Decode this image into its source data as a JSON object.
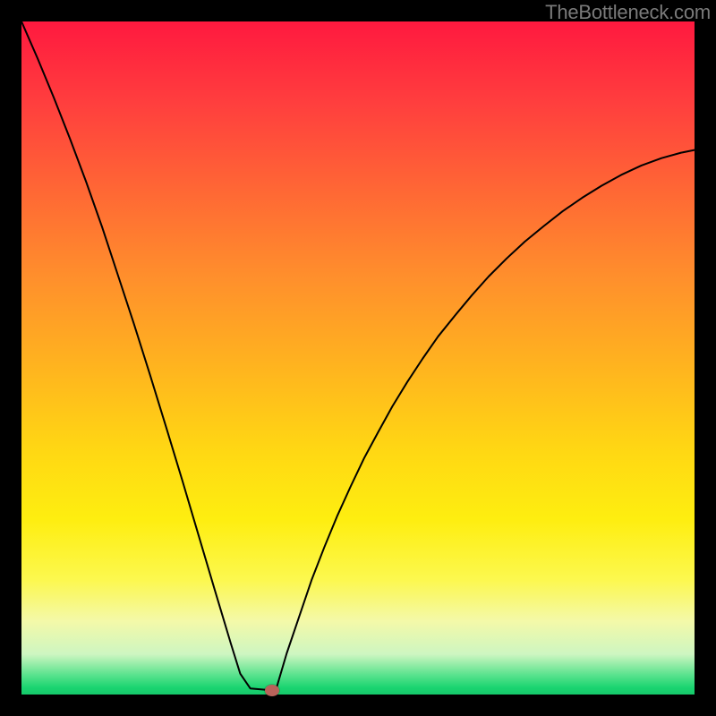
{
  "watermark": {
    "text": "TheBottleneck.com"
  },
  "plot": {
    "inner_left": 24,
    "inner_top": 24,
    "inner_width": 752,
    "inner_height": 752
  },
  "cursor": {
    "x_frac": 0.3723,
    "y_frac": 0.994,
    "color": "#b9625a"
  },
  "chart_data": {
    "type": "line",
    "title": "",
    "xlabel": "",
    "ylabel": "",
    "xlim": [
      0,
      1
    ],
    "ylim": [
      0,
      1
    ],
    "legend": false,
    "grid": false,
    "series": [
      {
        "name": "bottleneck-curve-left",
        "x": [
          0.0,
          0.024,
          0.048,
          0.072,
          0.096,
          0.12,
          0.143,
          0.167,
          0.191,
          0.215,
          0.239,
          0.263,
          0.287,
          0.311,
          0.325,
          0.34,
          0.375
        ],
        "values": [
          1.0,
          0.945,
          0.887,
          0.826,
          0.762,
          0.694,
          0.624,
          0.551,
          0.475,
          0.397,
          0.318,
          0.237,
          0.156,
          0.076,
          0.031,
          0.009,
          0.006
        ]
      },
      {
        "name": "bottleneck-curve-right",
        "x": [
          0.376,
          0.394,
          0.413,
          0.431,
          0.45,
          0.469,
          0.489,
          0.509,
          0.53,
          0.551,
          0.573,
          0.596,
          0.619,
          0.644,
          0.669,
          0.694,
          0.721,
          0.748,
          0.776,
          0.804,
          0.833,
          0.862,
          0.891,
          0.921,
          0.951,
          0.98,
          1.0
        ],
        "values": [
          0.0,
          0.061,
          0.117,
          0.17,
          0.219,
          0.265,
          0.309,
          0.351,
          0.39,
          0.428,
          0.464,
          0.499,
          0.532,
          0.563,
          0.593,
          0.621,
          0.648,
          0.673,
          0.696,
          0.718,
          0.738,
          0.756,
          0.772,
          0.786,
          0.797,
          0.805,
          0.809
        ]
      }
    ],
    "annotations": [
      {
        "name": "min-point-marker",
        "x": 0.372,
        "y": 0.006,
        "color": "#b9625a"
      }
    ],
    "background_gradient": [
      {
        "stop": 0.0,
        "color": "#ff193f"
      },
      {
        "stop": 0.12,
        "color": "#ff3e3e"
      },
      {
        "stop": 0.26,
        "color": "#ff6a34"
      },
      {
        "stop": 0.38,
        "color": "#ff8f2c"
      },
      {
        "stop": 0.51,
        "color": "#ffb31f"
      },
      {
        "stop": 0.64,
        "color": "#ffd813"
      },
      {
        "stop": 0.74,
        "color": "#feee10"
      },
      {
        "stop": 0.83,
        "color": "#fcf84f"
      },
      {
        "stop": 0.89,
        "color": "#f4f9a8"
      },
      {
        "stop": 0.94,
        "color": "#cef6c1"
      },
      {
        "stop": 0.97,
        "color": "#5de38f"
      },
      {
        "stop": 0.99,
        "color": "#1ad470"
      },
      {
        "stop": 1.0,
        "color": "#16c96b"
      }
    ]
  }
}
